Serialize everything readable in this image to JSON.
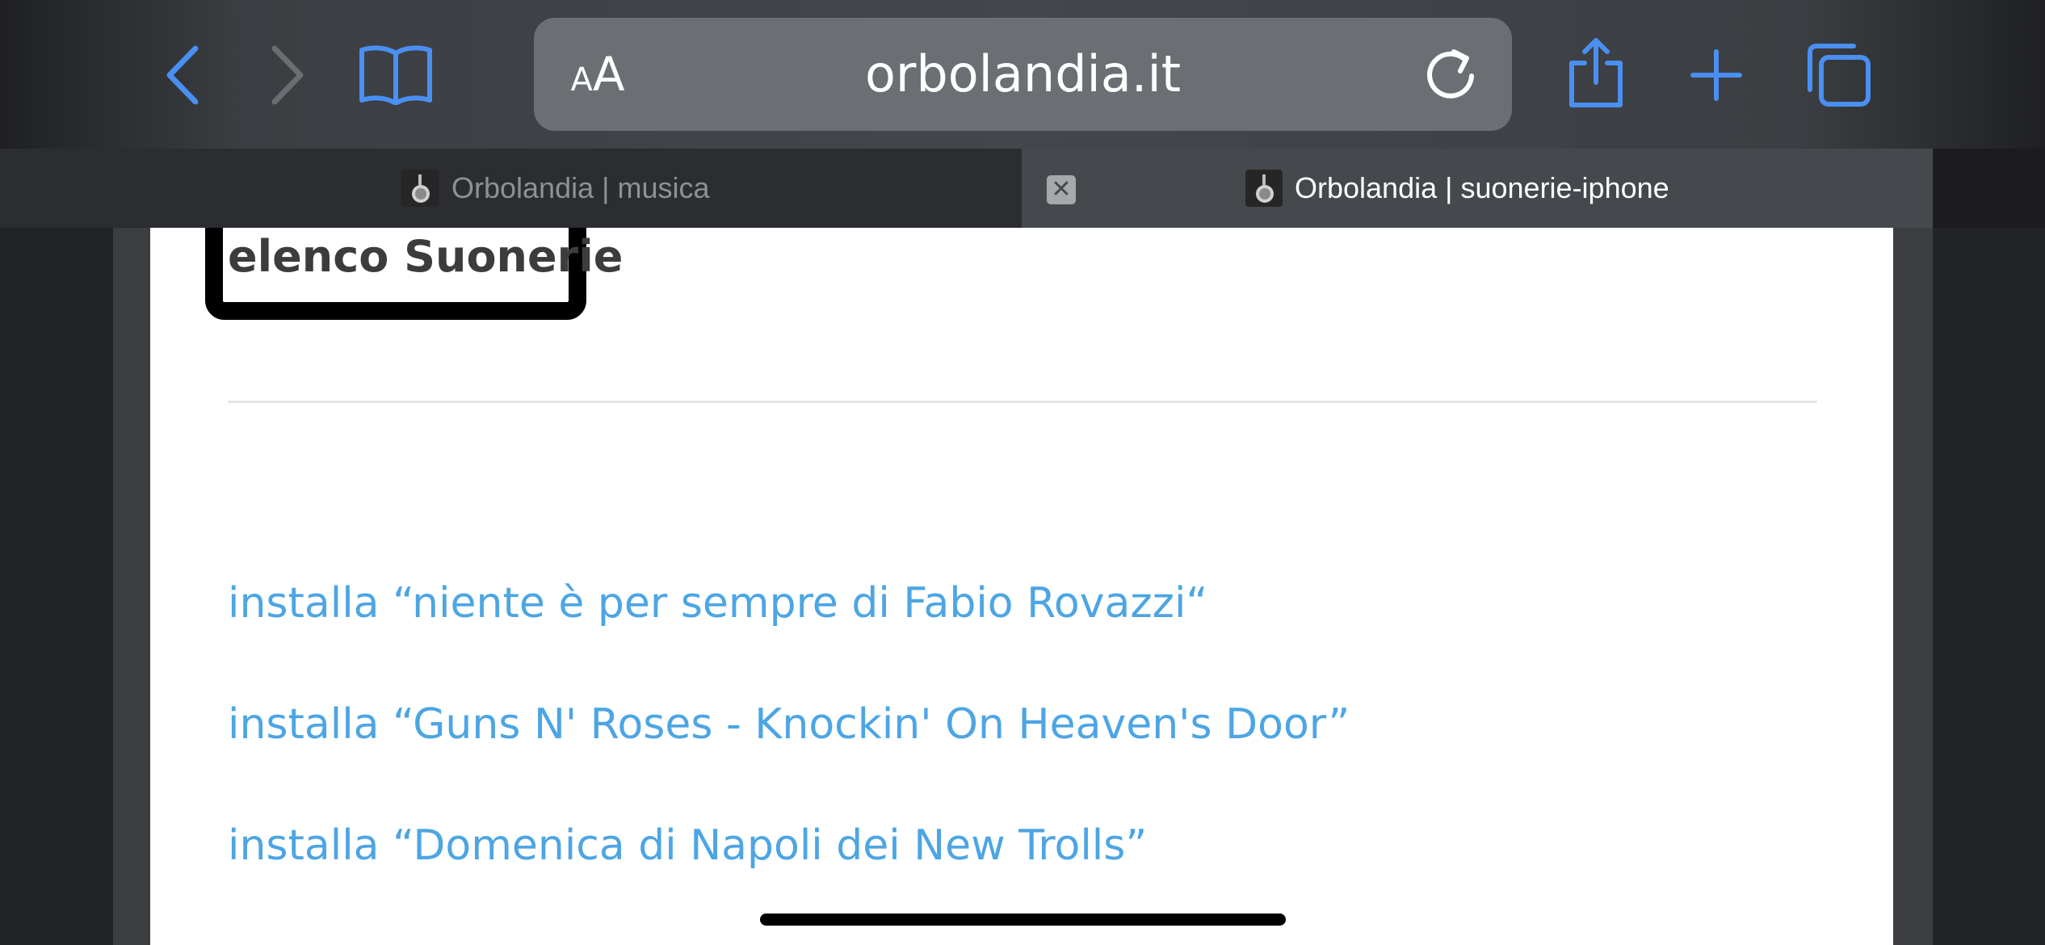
{
  "toolbar": {
    "url": "orbolandia.it",
    "aa_small": "A",
    "aa_big": "A"
  },
  "tabs": [
    {
      "title": "Orbolandia | musica",
      "active": false
    },
    {
      "title": "Orbolandia | suonerie-iphone",
      "active": true
    }
  ],
  "tab_close_glyph": "✕",
  "page": {
    "section_title": "elenco Suonerie",
    "ringtones": [
      "installa “niente è per sempre di Fabio Rovazzi“",
      "installa “Guns N' Roses - Knockin' On Heaven's Door”",
      "installa “Domenica di Napoli dei New Trolls”"
    ]
  },
  "colors": {
    "accent": "#4a8ff2",
    "link": "#4da5e3",
    "heading_text": "#3c3c3c"
  },
  "icons": [
    "back-icon",
    "forward-icon",
    "bookmarks-icon",
    "reload-icon",
    "share-icon",
    "plus-icon",
    "tabs-icon",
    "tab-close-icon"
  ]
}
